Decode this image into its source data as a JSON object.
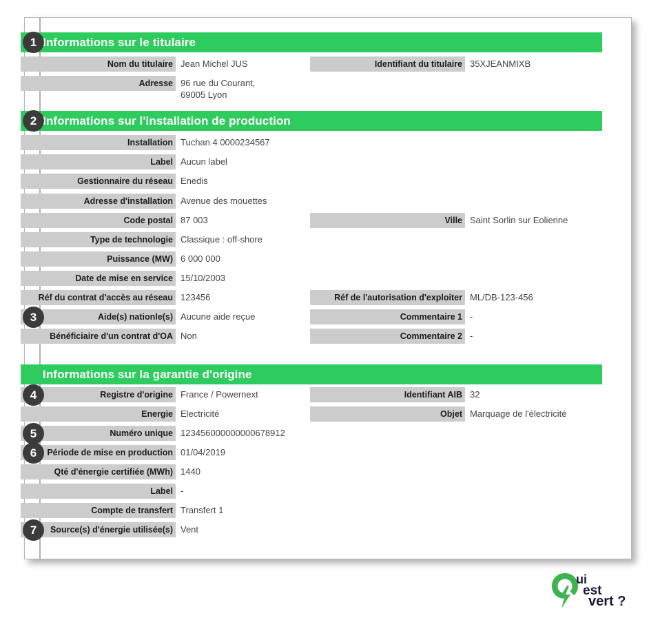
{
  "colors": {
    "accent_green": "#2ECC5E",
    "label_bar": "#cccccc",
    "bullet": "#3b3b3b",
    "value_text": "#444444"
  },
  "sections": [
    {
      "id": "titulaire",
      "number": "1",
      "header": "Informations sur le titulaire",
      "rows_left": [
        {
          "label": "Nom du titulaire",
          "value": "Jean Michel JUS"
        },
        {
          "label": "Adresse",
          "value": "96 rue du Courant,\n69005 Lyon"
        }
      ],
      "rows_right": [
        {
          "label": "Identifiant du titulaire",
          "value": "35XJEANMIXB"
        }
      ]
    },
    {
      "id": "installation",
      "number": "2",
      "header": "Informations sur l'installation de production",
      "rows_left": [
        {
          "label": "Installation",
          "value": "Tuchan 4 0000234567"
        },
        {
          "label": "Label",
          "value": "Aucun label"
        },
        {
          "label": "Gestionnaire du réseau",
          "value": "Enedis"
        },
        {
          "label": "Adresse d'installation",
          "value": "Avenue des mouettes"
        },
        {
          "label": "Code postal",
          "value": "87 003"
        },
        {
          "label": "Type de technologie",
          "value": "Classique : off-shore"
        },
        {
          "label": "Puissance (MW)",
          "value": "6 000 000"
        },
        {
          "label": "Date de mise en service",
          "value": "15/10/2003"
        },
        {
          "label": "Réf du contrat d'accès au réseau",
          "value": "123456"
        },
        {
          "label": "Aide(s) nationle(s)",
          "value": "Aucune aide reçue",
          "bullet": "3"
        },
        {
          "label": "Bénéficiaire d'un contrat d'OA",
          "value": "Non"
        }
      ],
      "rows_right": [
        {
          "label": "Ville",
          "value": "Saint Sorlin sur Eolienne"
        },
        {
          "label": "Réf de l'autorisation d'exploiter",
          "value": "ML/DB-123-456"
        },
        {
          "label": "Commentaire 1",
          "value": "-"
        },
        {
          "label": "Commentaire 2",
          "value": "-"
        }
      ]
    },
    {
      "id": "garantie",
      "number": "",
      "header": "Informations sur la garantie d'origine",
      "rows_left": [
        {
          "label": "Registre d'origine",
          "value": "France / Powernext",
          "bullet": "4"
        },
        {
          "label": "Energie",
          "value": "Electricité"
        },
        {
          "label": "Numéro unique",
          "value": "123456000000000678912",
          "bullet": "5"
        },
        {
          "label": "Période de mise en production",
          "value": "01/04/2019",
          "bullet": "6"
        },
        {
          "label": "Qté d'énergie certifiée (MWh)",
          "value": "1440"
        },
        {
          "label": "Label",
          "value": "-"
        },
        {
          "label": "Compte de transfert",
          "value": "Transfert 1"
        },
        {
          "label": "Source(s) d'énergie utilisée(s)",
          "value": "Vent",
          "bullet": "7"
        }
      ],
      "rows_right": [
        {
          "label": "Identifiant AIB",
          "value": "32"
        },
        {
          "label": "Objet",
          "value": "Marquage de l'électricité"
        }
      ]
    }
  ],
  "logo": {
    "name": "qui-est-vert-logo",
    "word1": "ui",
    "word2": "est",
    "word3": "vert ?",
    "letter": "Q"
  }
}
